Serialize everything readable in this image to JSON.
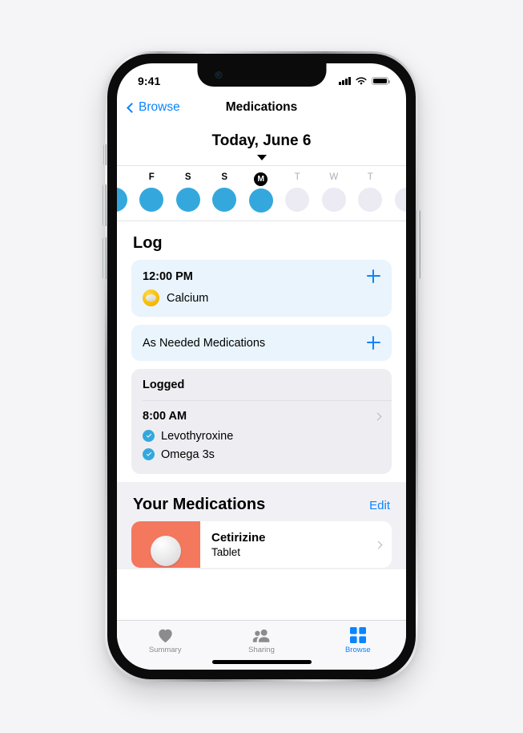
{
  "status_bar": {
    "time": "9:41",
    "signal_icon": "cellular-bars-icon",
    "wifi_icon": "wifi-icon",
    "battery_icon": "battery-icon"
  },
  "nav": {
    "back_label": "Browse",
    "back_icon": "chevron-left-icon",
    "title": "Medications"
  },
  "date_header": {
    "title": "Today, June 6",
    "caret_icon": "caret-down-icon"
  },
  "day_strip": {
    "days": [
      {
        "letter": "",
        "state": "past",
        "partial": true
      },
      {
        "letter": "F",
        "state": "past",
        "partial": false
      },
      {
        "letter": "S",
        "state": "past",
        "partial": false
      },
      {
        "letter": "S",
        "state": "past",
        "partial": false
      },
      {
        "letter": "M",
        "state": "today",
        "partial": false
      },
      {
        "letter": "T",
        "state": "future",
        "partial": false
      },
      {
        "letter": "W",
        "state": "future",
        "partial": false
      },
      {
        "letter": "T",
        "state": "future",
        "partial": false
      },
      {
        "letter": "",
        "state": "future",
        "partial": true
      }
    ]
  },
  "log": {
    "section_title": "Log",
    "scheduled": {
      "time": "12:00 PM",
      "add_icon": "plus-icon",
      "medication": "Calcium",
      "pill_icon": "yellow-capsule-icon"
    },
    "as_needed": {
      "label": "As Needed Medications",
      "add_icon": "plus-icon"
    },
    "logged": {
      "header": "Logged",
      "time": "8:00 AM",
      "disclosure_icon": "chevron-right-icon",
      "items": [
        {
          "name": "Levothyroxine",
          "icon": "check-circle-icon"
        },
        {
          "name": "Omega 3s",
          "icon": "check-circle-icon"
        }
      ]
    }
  },
  "your_medications": {
    "title": "Your Medications",
    "edit_label": "Edit",
    "items": [
      {
        "name": "Cetirizine",
        "form": "Tablet",
        "thumb_color": "#f4785e",
        "pill_icon": "white-round-tablet-icon",
        "disclosure_icon": "chevron-right-icon"
      }
    ]
  },
  "tab_bar": {
    "tabs": [
      {
        "label": "Summary",
        "icon": "heart-icon",
        "active": false
      },
      {
        "label": "Sharing",
        "icon": "people-icon",
        "active": false
      },
      {
        "label": "Browse",
        "icon": "grid-icon",
        "active": true
      }
    ]
  },
  "colors": {
    "accent_blue": "#0a84ff",
    "dot_blue": "#34a8dd",
    "card_blue": "#e9f4fd",
    "card_gray": "#eeeef2",
    "page_gray": "#f1f1f5",
    "pill_yellow": "#f5b800",
    "thumb_coral": "#f4785e"
  }
}
